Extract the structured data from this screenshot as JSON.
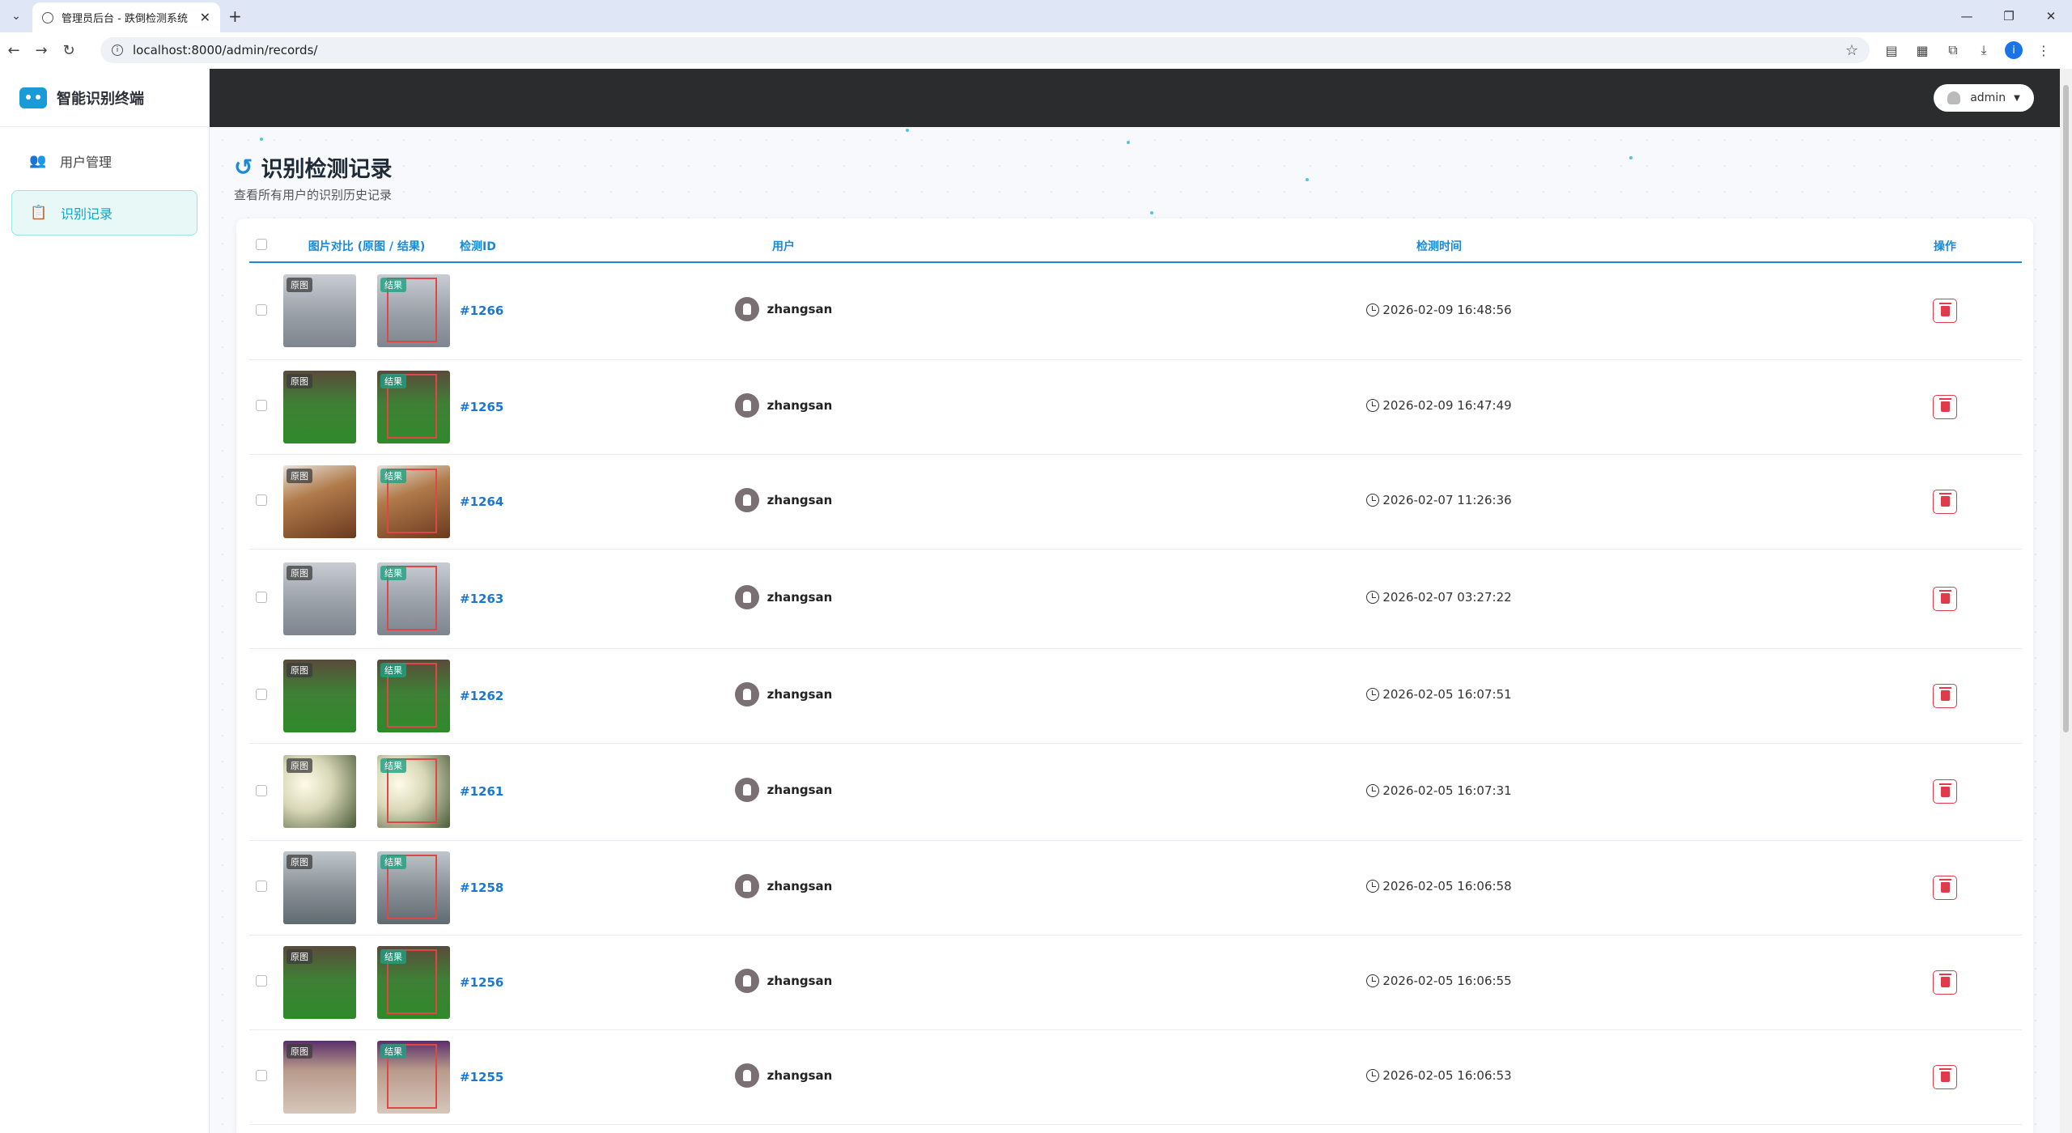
{
  "browser": {
    "tab_title": "管理员后台 - 跌倒检测系统",
    "url": "localhost:8000/admin/records/"
  },
  "sidebar": {
    "brand": "智能识别终端",
    "items": [
      {
        "label": "用户管理",
        "icon": "users-icon"
      },
      {
        "label": "识别记录",
        "icon": "clipboard-icon",
        "active": true
      }
    ]
  },
  "header": {
    "user": "admin"
  },
  "page": {
    "title": "识别检测记录",
    "subtitle": "查看所有用户的识别历史记录"
  },
  "table": {
    "headers": {
      "images": "图片对比 (原图 / 结果)",
      "id": "检测ID",
      "user": "用户",
      "time": "检测时间",
      "action": "操作"
    },
    "tag_original": "原图",
    "tag_result": "结果",
    "rows": [
      {
        "id": "#1266",
        "user": "zhangsan",
        "time": "2026-02-09 16:48:56",
        "scene": "lab"
      },
      {
        "id": "#1265",
        "user": "zhangsan",
        "time": "2026-02-09 16:47:49",
        "scene": "field"
      },
      {
        "id": "#1264",
        "user": "zhangsan",
        "time": "2026-02-07 11:26:36",
        "scene": "indoor"
      },
      {
        "id": "#1263",
        "user": "zhangsan",
        "time": "2026-02-07 03:27:22",
        "scene": "lab"
      },
      {
        "id": "#1262",
        "user": "zhangsan",
        "time": "2026-02-05 16:07:51",
        "scene": "field"
      },
      {
        "id": "#1261",
        "user": "zhangsan",
        "time": "2026-02-05 16:07:31",
        "scene": "bright"
      },
      {
        "id": "#1258",
        "user": "zhangsan",
        "time": "2026-02-05 16:06:58",
        "scene": "floor"
      },
      {
        "id": "#1256",
        "user": "zhangsan",
        "time": "2026-02-05 16:06:55",
        "scene": "field"
      },
      {
        "id": "#1255",
        "user": "zhangsan",
        "time": "2026-02-05 16:06:53",
        "scene": "crowd"
      }
    ]
  },
  "colors": {
    "accent": "#1a8ad6",
    "danger": "#e03b4a",
    "header_bg": "#2b2c2e",
    "active_bg": "#e7f8f7"
  }
}
